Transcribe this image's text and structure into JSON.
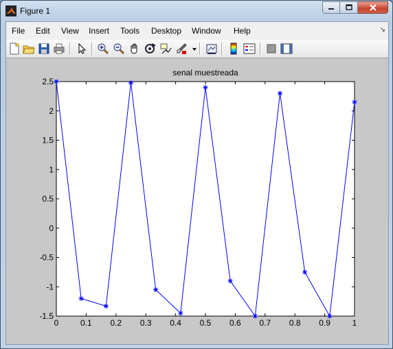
{
  "window": {
    "title": "Figure 1"
  },
  "menu": [
    "File",
    "Edit",
    "View",
    "Insert",
    "Tools",
    "Desktop",
    "Window",
    "Help"
  ],
  "toolbar": {
    "icons": [
      "new-figure-icon",
      "open-icon",
      "save-icon",
      "print-icon",
      "pointer-icon",
      "zoom-in-icon",
      "zoom-out-icon",
      "pan-icon",
      "rotate-icon",
      "data-cursor-icon",
      "brush-icon",
      "link-plot-icon",
      "colorbar-icon",
      "legend-icon",
      "hide-plot-tools-icon",
      "show-plot-tools-icon"
    ]
  },
  "chart_data": {
    "type": "line",
    "title": "senal muestreada",
    "xlabel": "",
    "ylabel": "",
    "xlim": [
      0,
      1
    ],
    "ylim": [
      -1.5,
      2.5
    ],
    "xticks": [
      "0",
      "0.1",
      "0.2",
      "0.3",
      "0.4",
      "0.5",
      "0.6",
      "0.7",
      "0.8",
      "0.9",
      "1"
    ],
    "yticks": [
      "2.5",
      "2",
      "1.5",
      "1",
      "0.5",
      "0",
      "-0.5",
      "-1",
      "-1.5"
    ],
    "marker": "*",
    "color": "#0000ff",
    "x": [
      0,
      0.0833,
      0.1667,
      0.25,
      0.3333,
      0.4167,
      0.5,
      0.5833,
      0.6667,
      0.75,
      0.8333,
      0.9167,
      1.0
    ],
    "y": [
      2.5,
      -1.2,
      -1.33,
      2.48,
      -1.05,
      -1.45,
      2.4,
      -0.9,
      -1.5,
      2.3,
      -0.75,
      -1.5,
      2.15
    ]
  }
}
